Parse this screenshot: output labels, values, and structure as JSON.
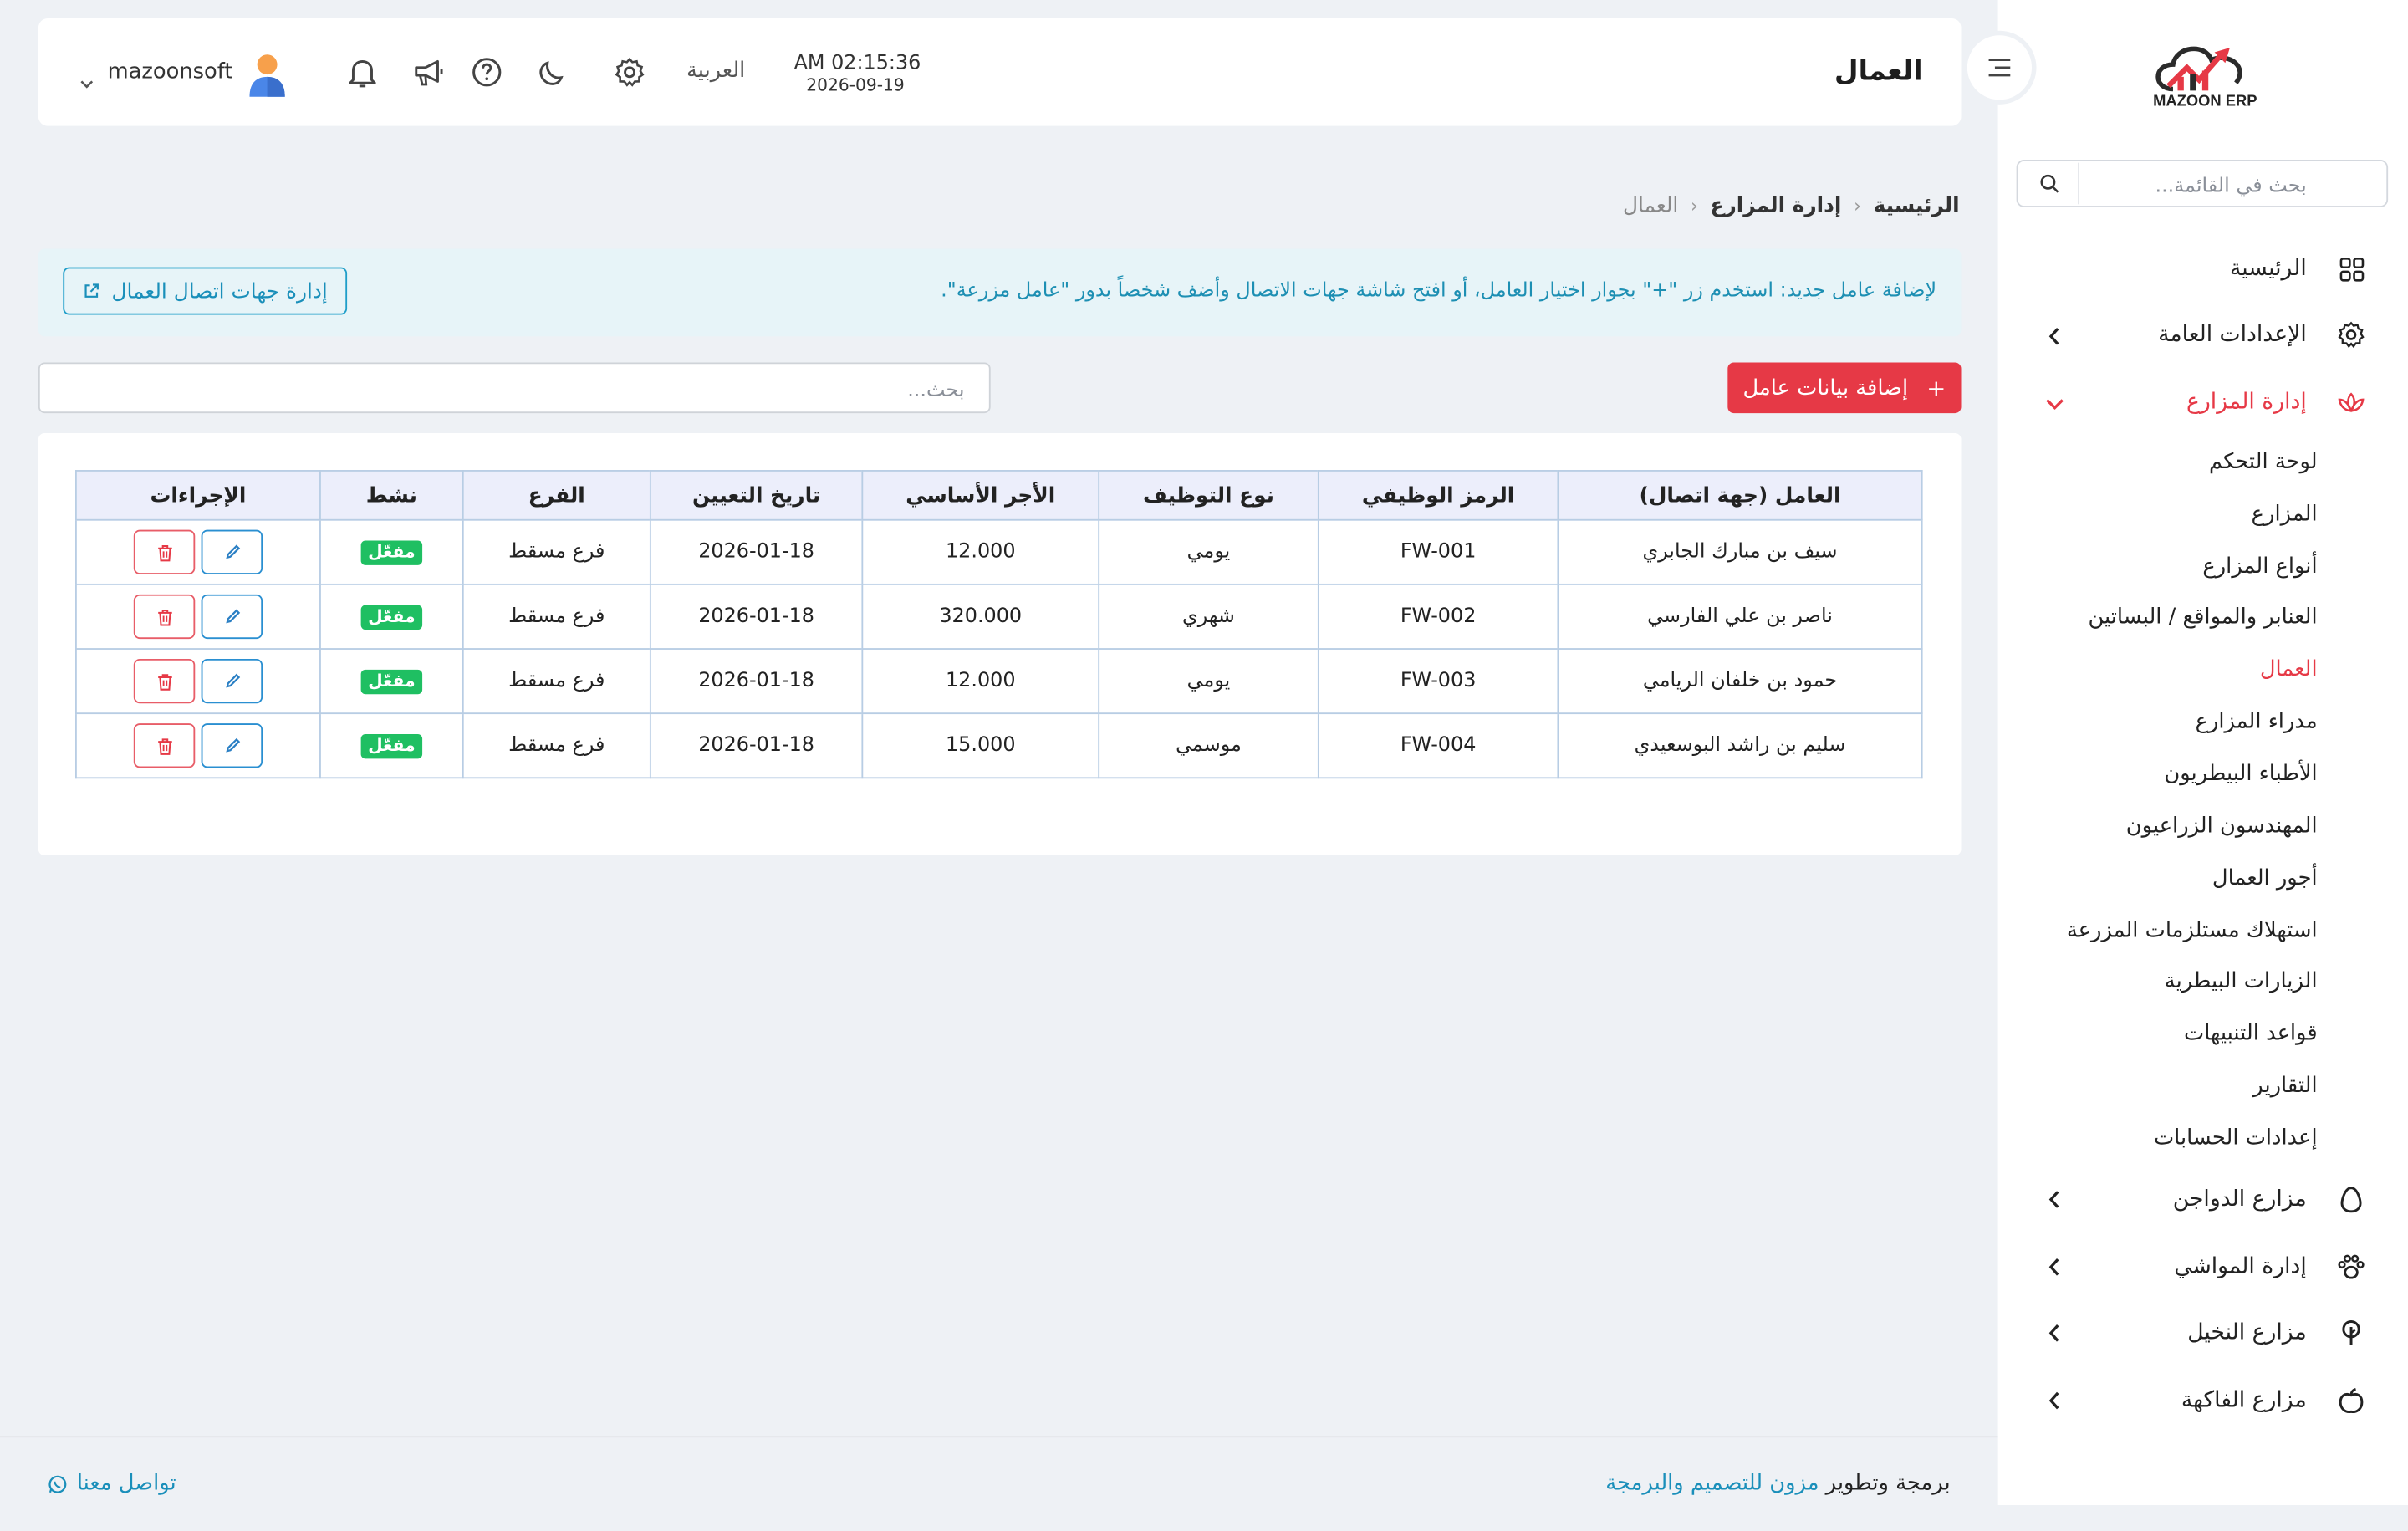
{
  "brand": {
    "logo_text": "MAZOON ERP",
    "logo_sub": "ERP"
  },
  "sidebar": {
    "search_placeholder": "بحث في القائمة...",
    "items": [
      {
        "label": "الرئيسية",
        "icon": "grid-icon"
      },
      {
        "label": "الإعدادات العامة",
        "icon": "gear-icon"
      },
      {
        "label": "إدارة المزارع",
        "icon": "lotus-icon",
        "active": true
      },
      {
        "label": "مزارع الدواجن",
        "icon": "egg-icon"
      },
      {
        "label": "إدارة المواشي",
        "icon": "paw-icon"
      },
      {
        "label": "مزارع النخيل",
        "icon": "tree-icon"
      },
      {
        "label": "مزارع الفاكهة",
        "icon": "apple-icon"
      }
    ],
    "submenu": [
      "لوحة التحكم",
      "المزارع",
      "أنواع المزارع",
      "العنابر والمواقع / البساتين",
      "العمال",
      "مدراء المزارع",
      "الأطباء البيطريون",
      "المهندسون الزراعيون",
      "أجور العمال",
      "استهلاك مستلزمات المزرعة",
      "الزيارات البيطرية",
      "قواعد التنبيهات",
      "التقارير",
      "إعدادات الحسابات"
    ],
    "active_submenu": "العمال"
  },
  "header": {
    "title": "العمال",
    "time": "AM 02:15:36",
    "date": "2026-09-19",
    "language": "العربية",
    "username": "mazoonsoft"
  },
  "breadcrumb": {
    "home": "الرئيسية",
    "section": "إدارة المزارع",
    "current": "العمال"
  },
  "info": {
    "text": "لإضافة عامل جديد: استخدم زر \"+\" بجوار اختيار العامل، أو افتح شاشة جهات الاتصال وأضف شخصاً بدور \"عامل مزرعة\".",
    "button": "إدارة جهات اتصال العمال"
  },
  "toolbar": {
    "add_label": "إضافة بيانات عامل",
    "add_symbol": "+",
    "search_placeholder": "بحث..."
  },
  "table": {
    "columns": [
      "العامل (جهة اتصال)",
      "الرمز الوظيفي",
      "نوع التوظيف",
      "الأجر الأساسي",
      "تاريخ التعيين",
      "الفرع",
      "نشط",
      "الإجراءات"
    ],
    "rows": [
      {
        "name": "سيف بن مبارك الجابري",
        "code": "FW-001",
        "type": "يومي",
        "wage": "12.000",
        "date": "2026-01-18",
        "branch": "فرع مسقط",
        "status": "مفعّل"
      },
      {
        "name": "ناصر بن علي الفارسي",
        "code": "FW-002",
        "type": "شهري",
        "wage": "320.000",
        "date": "2026-01-18",
        "branch": "فرع مسقط",
        "status": "مفعّل"
      },
      {
        "name": "حمود بن خلفان الريامي",
        "code": "FW-003",
        "type": "يومي",
        "wage": "12.000",
        "date": "2026-01-18",
        "branch": "فرع مسقط",
        "status": "مفعّل"
      },
      {
        "name": "سليم بن راشد البوسعيدي",
        "code": "FW-004",
        "type": "موسمي",
        "wage": "15.000",
        "date": "2026-01-18",
        "branch": "فرع مسقط",
        "status": "مفعّل"
      }
    ]
  },
  "footer": {
    "credit_prefix": "برمجة وتطوير",
    "credit_link": "مزون للتصميم والبرمجة",
    "contact": "تواصل معنا"
  },
  "colors": {
    "accent": "#e63946",
    "info_text": "#1d8fb3",
    "badge": "#1fbf62",
    "link": "#1a8fba"
  }
}
